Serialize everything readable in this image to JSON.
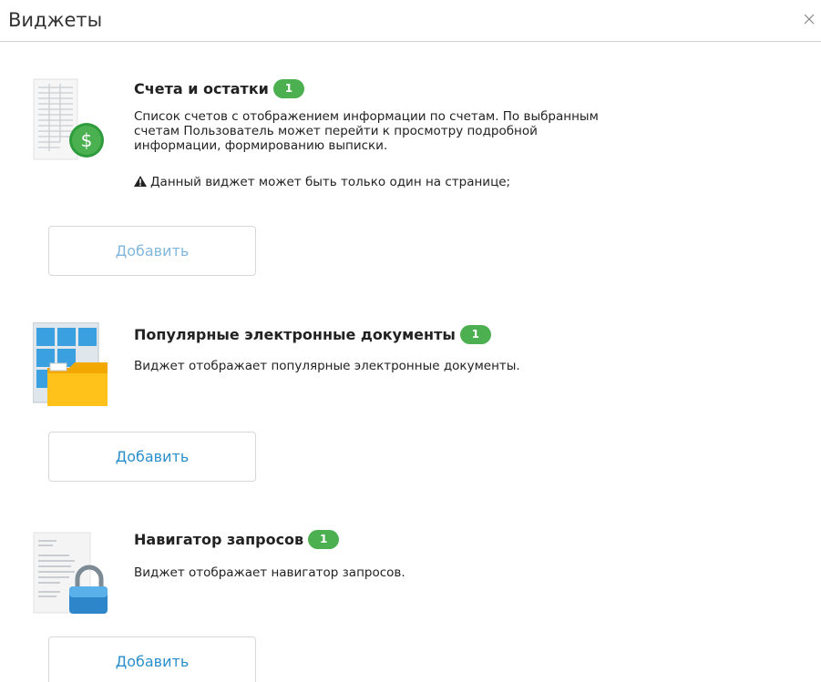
{
  "dialog": {
    "title": "Виджеты",
    "close_icon": "close-icon"
  },
  "widgets": [
    {
      "title": "Счета и остатки",
      "badge": "1",
      "description": "Список счетов с отображением информации по счетам. По выбранным счетам Пользователь может перейти к просмотру подробной информации, формированию выписки.",
      "warning": "Данный виджет может быть только один на странице;",
      "icon": "accounts-dollar-icon",
      "add_label": "Добавить",
      "add_disabled": true
    },
    {
      "title": "Популярные электронные документы",
      "badge": "1",
      "description": "Виджет отображает популярные электронные документы.",
      "icon": "documents-folder-icon",
      "add_label": "Добавить",
      "add_disabled": false
    },
    {
      "title": "Навигатор запросов",
      "badge": "1",
      "description": "Виджет отображает навигатор запросов.",
      "icon": "request-lock-icon",
      "add_label": "Добавить",
      "add_disabled": false
    }
  ],
  "colors": {
    "badge": "#4caf50",
    "button_text": "#2a8fcc",
    "divider": "#cfcfcf"
  }
}
